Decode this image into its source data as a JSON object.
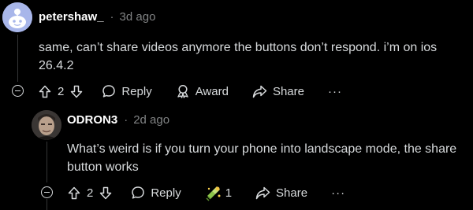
{
  "comments": [
    {
      "username": "petershaw_",
      "separator": "·",
      "time": "3d ago",
      "text": "same, can’t share videos anymore the buttons don’t respond. i’m on ios 26.4.2",
      "score": "2",
      "reply_label": "Reply",
      "award_label": "Award",
      "share_label": "Share",
      "more_label": "···"
    },
    {
      "username": "ODRON3",
      "separator": "·",
      "time": "2d ago",
      "text": "What’s weird is if you turn your phone into landscape mode, the share button works",
      "score": "2",
      "reply_label": "Reply",
      "award_count": "1",
      "share_label": "Share",
      "more_label": "···"
    }
  ],
  "icons": {
    "collapse": "collapse-icon",
    "upvote": "upvote-arrow-icon",
    "downvote": "downvote-arrow-icon",
    "reply": "speech-bubble-icon",
    "award": "award-ribbon-icon",
    "share": "share-arrow-icon",
    "more": "more-dots-icon"
  },
  "colors": {
    "background": "#000000",
    "text": "#d7dadc",
    "muted": "#818384",
    "avatar_bg": "#a8b6ea"
  }
}
